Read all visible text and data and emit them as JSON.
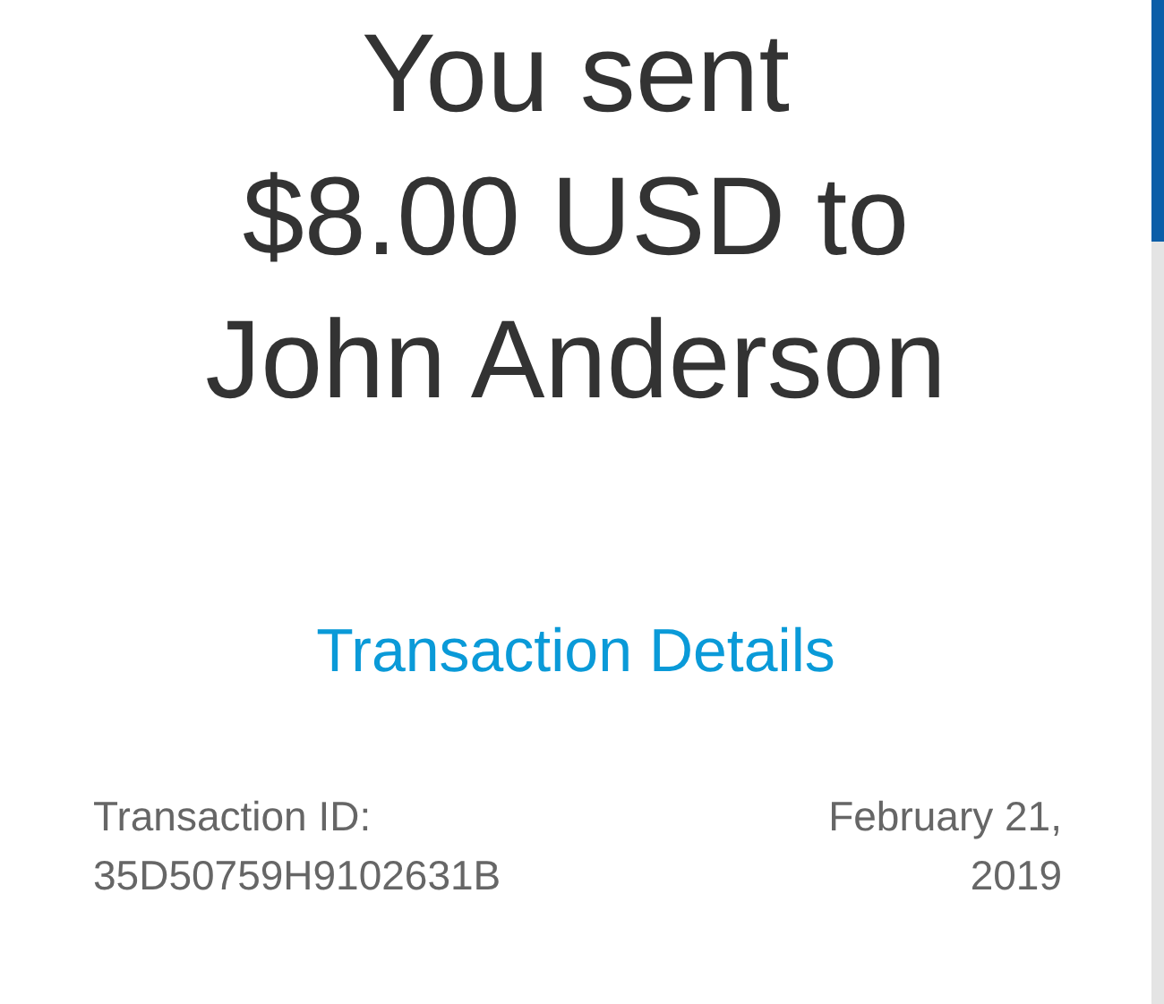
{
  "heading_lines": [
    "You sent",
    "$8.00 USD to",
    "John Anderson"
  ],
  "details_link": "Transaction Details",
  "transaction_id": "Transaction ID: 35D50759H9102631B",
  "date": "February 21, 2019"
}
